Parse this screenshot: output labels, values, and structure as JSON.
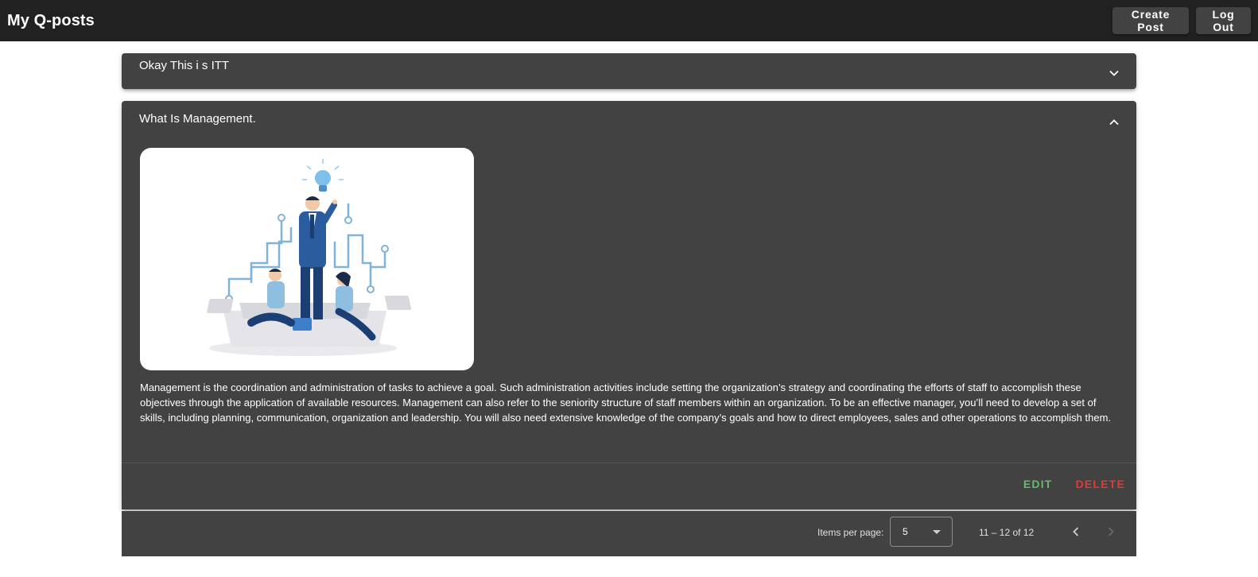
{
  "toolbar": {
    "title": "My Q-posts",
    "create_label": "Create Post",
    "logout_label": "Log Out"
  },
  "posts": [
    {
      "title": "Okay This i s ITT",
      "expanded": false,
      "chevron_icon": "chevron-down-icon"
    },
    {
      "title": "What Is Management.",
      "expanded": true,
      "chevron_icon": "chevron-up-icon",
      "image": "management-illustration",
      "body": "Management is the coordination and administration of tasks to achieve a goal. Such administration activities include setting the organization’s strategy and coordinating the efforts of staff to accomplish these objectives through the application of available resources. Management can also refer to the seniority structure of staff members within an organization. To be an effective manager, you’ll need to develop a set of skills, including planning, communication, organization and leadership. You will also need extensive knowledge of the company’s goals and how to direct employees, sales and other operations to accomplish them.",
      "edit_label": "EDIT",
      "delete_label": "DELETE"
    }
  ],
  "paginator": {
    "items_per_page_label": "Items per page:",
    "page_size": "5",
    "range_label": "11 – 12 of 12",
    "prev_icon": "chevron-left-icon",
    "next_icon": "chevron-right-icon"
  },
  "colors": {
    "toolbar": "#212121",
    "panel": "#424242",
    "edit": "#66bb6a",
    "delete": "#e53935"
  }
}
